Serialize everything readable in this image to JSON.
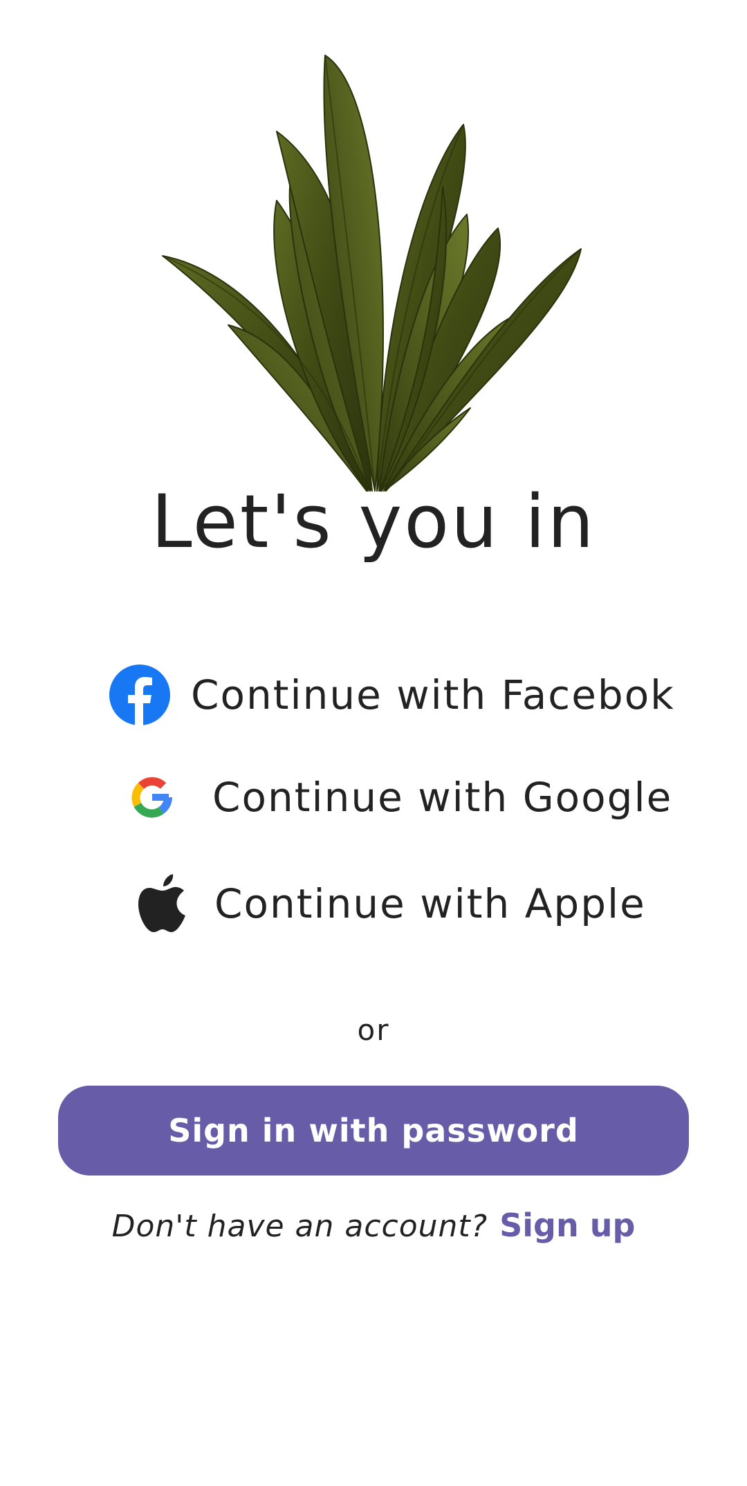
{
  "title": "Let's you in",
  "social": {
    "facebook_label": "Continue with Facebok",
    "google_label": "Continue with Google",
    "apple_label": "Continue with Apple"
  },
  "divider_text": "or",
  "primary_button_label": "Sign in with password",
  "footer": {
    "prompt": "Don't have an account?",
    "link": "Sign up"
  },
  "colors": {
    "accent": "#665ca8",
    "facebook": "#1877f2",
    "text": "#222222",
    "plant": "#4f5a1c"
  },
  "icons": [
    "plant-illustration",
    "facebook-icon",
    "google-icon",
    "apple-icon"
  ]
}
